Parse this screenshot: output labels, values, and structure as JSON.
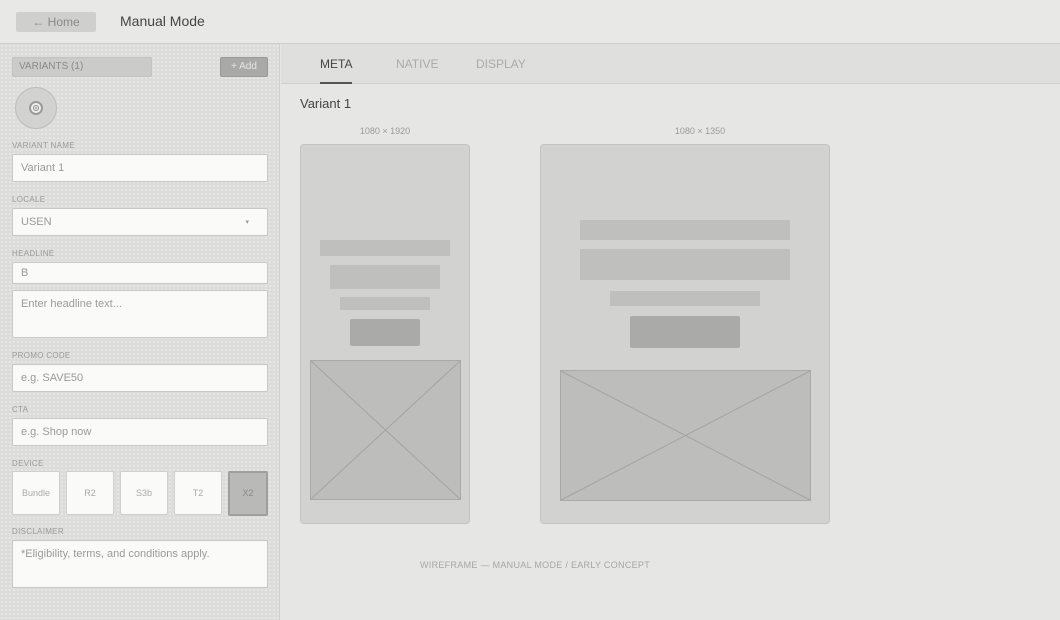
{
  "header": {
    "home_label": "← Home",
    "title": "Manual Mode"
  },
  "sidebar": {
    "variants_label": "VARIANTS (1)",
    "add_label": "+ Add",
    "fields": {
      "variant_name": {
        "label": "VARIANT NAME",
        "value": "Variant 1"
      },
      "locale": {
        "label": "LOCALE",
        "value": "USEN",
        "caret": "▾"
      },
      "headline": {
        "label": "HEADLINE",
        "bold_value": "B",
        "placeholder": "Enter headline text..."
      },
      "promo_code": {
        "label": "PROMO CODE",
        "placeholder": "e.g. SAVE50"
      },
      "cta": {
        "label": "CTA",
        "placeholder": "e.g. Shop now"
      },
      "device": {
        "label": "DEVICE",
        "options": [
          "Bundle",
          "R2",
          "S3b",
          "T2",
          "X2"
        ],
        "selected": "X2"
      },
      "disclaimer": {
        "label": "DISCLAIMER",
        "value": "*Eligibility, terms, and conditions apply."
      }
    }
  },
  "tabs": [
    {
      "label": "META",
      "active": true
    },
    {
      "label": "NATIVE",
      "active": false
    },
    {
      "label": "DISPLAY",
      "active": false
    }
  ],
  "main": {
    "variant_title": "Variant 1",
    "previews": [
      {
        "dimensions": "1080 × 1920"
      },
      {
        "dimensions": "1080 × 1350"
      }
    ],
    "footer_note": "WIREFRAME — MANUAL MODE / EARLY CONCEPT"
  },
  "icons": {
    "home": "arrow-left-icon",
    "avatar": "gear-icon",
    "caret": "chevron-down-icon"
  }
}
